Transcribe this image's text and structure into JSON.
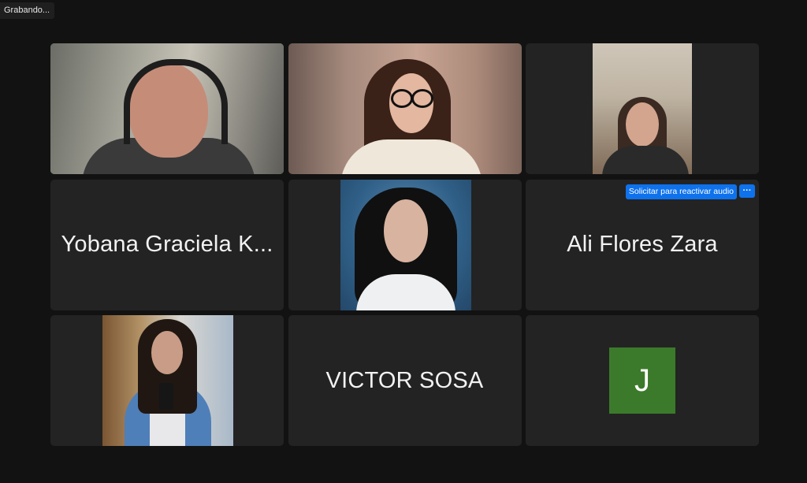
{
  "status": {
    "recording_label": "Grabando..."
  },
  "colors": {
    "background": "#121212",
    "tile": "#232323",
    "active_speaker": "#3fcf4f",
    "accent_blue": "#0e72ed",
    "avatar_green": "#3b7a2a"
  },
  "participants": [
    {
      "type": "video",
      "active": true
    },
    {
      "type": "video"
    },
    {
      "type": "video"
    },
    {
      "type": "name",
      "name": "Yobana Graciela K..."
    },
    {
      "type": "photo"
    },
    {
      "type": "name",
      "name": "Ali Flores Zara",
      "unmute_request_label": "Solicitar para reactivar audio",
      "more_label": "···"
    },
    {
      "type": "photo"
    },
    {
      "type": "name",
      "name": "VICTOR SOSA"
    },
    {
      "type": "avatar",
      "initial": "J"
    }
  ]
}
